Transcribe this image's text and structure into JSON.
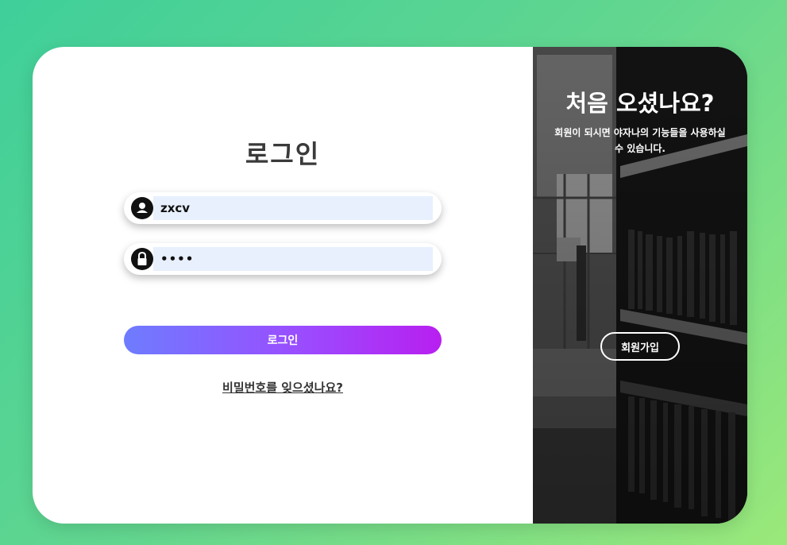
{
  "login": {
    "title": "로그인",
    "username_value": "zxcv",
    "password_value": "••••",
    "submit_label": "로그인",
    "forgot_link": "비밀번호를 잊으셨나요?"
  },
  "signup_panel": {
    "title": "처음 오셨나요?",
    "subtitle": "회원이 되시면 야자나의 기능들을 사용하실 수 있습니다.",
    "button_label": "회원가입"
  },
  "icons": {
    "username": "user-icon",
    "password": "lock-icon"
  },
  "colors": {
    "background_start": "#3fcf9a",
    "background_end": "#9ae87a",
    "button_gradient_start": "#6e7cff",
    "button_gradient_end": "#b81ff0",
    "input_fill": "#e8f0fe"
  }
}
